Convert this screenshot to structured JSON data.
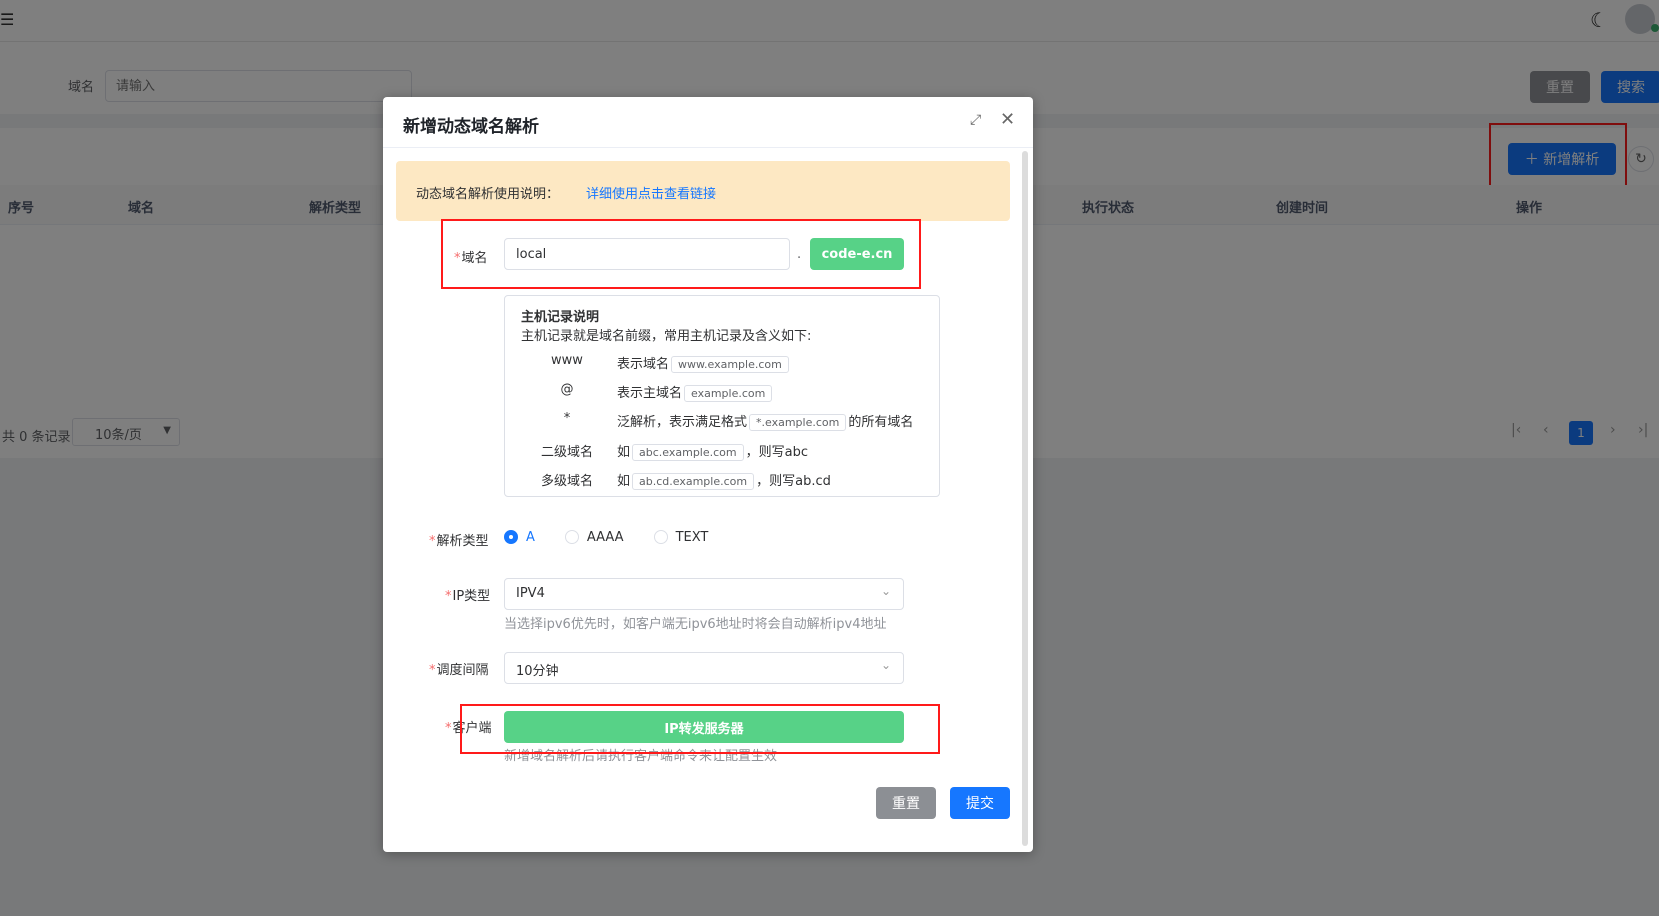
{
  "background": {
    "search": {
      "label": "域名",
      "placeholder": "请输入",
      "reset_label": "重置",
      "search_label": "搜索"
    },
    "toolbar": {
      "add_label": "＋ 新增解析"
    },
    "table": {
      "columns": [
        "序号",
        "域名",
        "解析类型",
        "执行状态",
        "创建时间",
        "操作"
      ]
    },
    "pager": {
      "total": "共 0 条记录",
      "page_size": "10条/页",
      "current_page": "1"
    }
  },
  "dialog": {
    "title": "新增动态域名解析",
    "notice": {
      "label": "动态域名解析使用说明：",
      "link": "详细使用点击查看链接"
    },
    "domain": {
      "label": "域名",
      "value": "local",
      "dot": ".",
      "suffix": "code-e.cn"
    },
    "host_help": {
      "title": "主机记录说明",
      "desc": "主机记录就是域名前缀，常用主机记录及含义如下:",
      "rows": [
        {
          "key": "www",
          "pre": "表示域名",
          "tag": "www.example.com",
          "post": ""
        },
        {
          "key": "@",
          "pre": "表示主域名",
          "tag": "example.com",
          "post": ""
        },
        {
          "key": "*",
          "pre": "泛解析，表示满足格式",
          "tag": "*.example.com",
          "post": "的所有域名"
        },
        {
          "key": "二级域名",
          "pre": "如",
          "tag": "abc.example.com",
          "post": "，则写abc"
        },
        {
          "key": "多级域名",
          "pre": "如",
          "tag": "ab.cd.example.com",
          "post": "，则写ab.cd"
        }
      ]
    },
    "record_type": {
      "label": "解析类型",
      "options": [
        "A",
        "AAAA",
        "TEXT"
      ],
      "selected": "A"
    },
    "ip_type": {
      "label": "IP类型",
      "value": "IPV4",
      "hint": "当选择ipv6优先时，如客户端无ipv6地址时将会自动解析ipv4地址"
    },
    "interval": {
      "label": "调度间隔",
      "value": "10分钟"
    },
    "client": {
      "label": "客户端",
      "button": "IP转发服务器",
      "hint": "新增域名解析后请执行客户端命令来让配置生效"
    },
    "reset_label": "重置",
    "submit_label": "提交"
  },
  "colors": {
    "primary": "#1677ff",
    "success": "#57d287",
    "warning_bg": "#fde8c3",
    "annotation": "#ff1a1a"
  }
}
